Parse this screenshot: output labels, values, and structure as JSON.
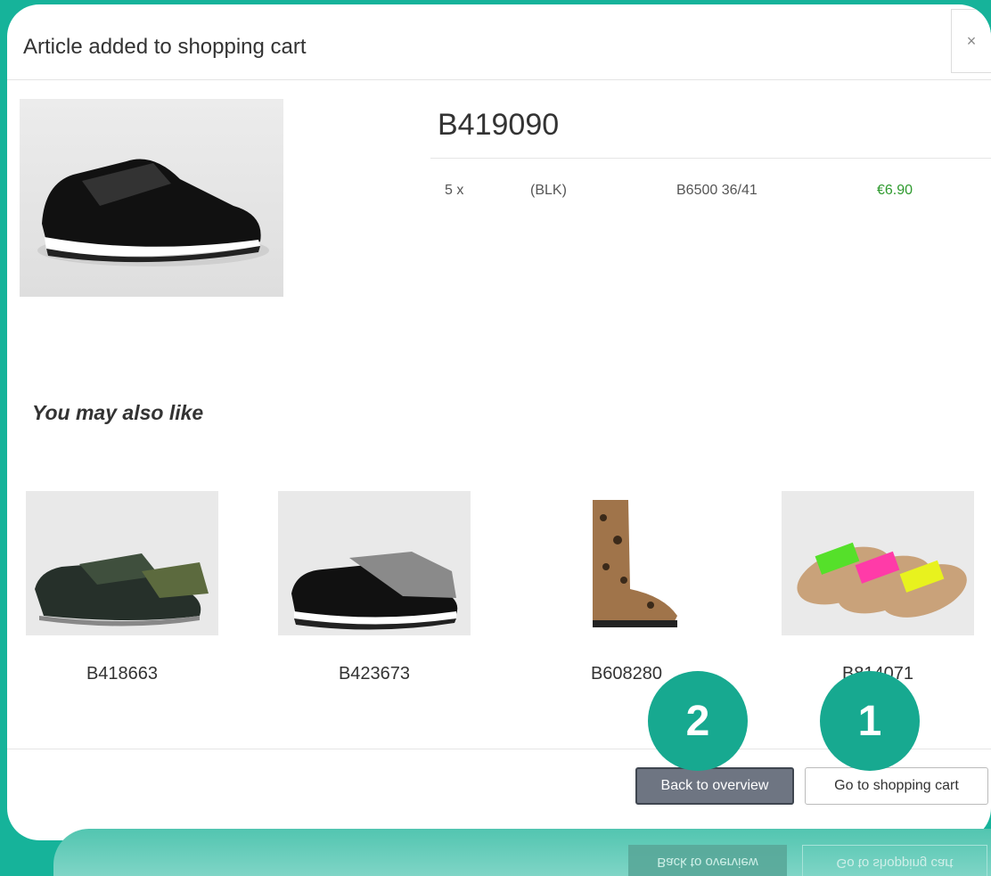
{
  "modal": {
    "title": "Article added to shopping cart",
    "close_label": "×"
  },
  "product": {
    "code": "B419090",
    "quantity": "5 x",
    "color": "(BLK)",
    "size": "B6500 36/41",
    "price": "€6.90"
  },
  "recommendations": {
    "heading": "You may also like",
    "items": [
      {
        "code": "B418663"
      },
      {
        "code": "B423673"
      },
      {
        "code": "B608280"
      },
      {
        "code": "B814071"
      }
    ]
  },
  "footer": {
    "back_label": "Back to overview",
    "cart_label": "Go to shopping cart"
  },
  "badges": {
    "one": "1",
    "two": "2"
  },
  "colors": {
    "background": "#16b39a",
    "badge": "#17a990",
    "price": "#2e9a2e",
    "back_button": "#6e7582"
  }
}
